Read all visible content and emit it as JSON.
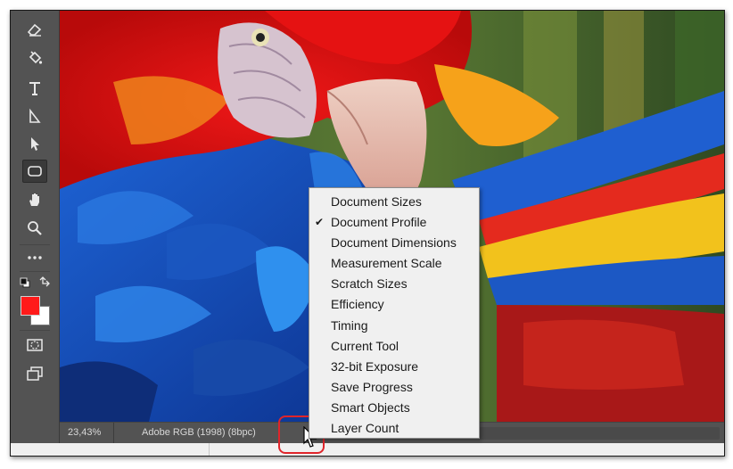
{
  "status_bar": {
    "zoom": "23,43%",
    "doc_info": "Adobe RGB (1998) (8bpc)",
    "arrow_icon": "chevron-right-icon"
  },
  "toolbar": {
    "tools": [
      {
        "name": "eraser-tool",
        "icon": "eraser-icon"
      },
      {
        "name": "fill-tool",
        "icon": "paint-bucket-icon"
      },
      {
        "name": "type-tool",
        "icon": "type-icon"
      },
      {
        "name": "path-selection-tool",
        "icon": "path-selection-icon"
      },
      {
        "name": "direct-selection-tool",
        "icon": "direct-selection-icon"
      },
      {
        "name": "rectangle-tool",
        "icon": "rounded-rectangle-icon",
        "active": true
      },
      {
        "name": "hand-tool",
        "icon": "hand-icon"
      },
      {
        "name": "zoom-tool",
        "icon": "magnifier-icon"
      },
      {
        "name": "more-tools",
        "icon": "ellipsis-icon"
      },
      {
        "name": "quick-mask-tool",
        "icon": "quick-mask-icon"
      },
      {
        "name": "screen-mode-tool",
        "icon": "screen-mode-icon"
      }
    ],
    "foreground_color": "#ff1a1a",
    "background_color": "#ffffff"
  },
  "menu": {
    "items": [
      {
        "label": "Document Sizes",
        "checked": false
      },
      {
        "label": "Document Profile",
        "checked": true
      },
      {
        "label": "Document Dimensions",
        "checked": false
      },
      {
        "label": "Measurement Scale",
        "checked": false
      },
      {
        "label": "Scratch Sizes",
        "checked": false
      },
      {
        "label": "Efficiency",
        "checked": false
      },
      {
        "label": "Timing",
        "checked": false
      },
      {
        "label": "Current Tool",
        "checked": false
      },
      {
        "label": "32-bit Exposure",
        "checked": false
      },
      {
        "label": "Save Progress",
        "checked": false
      },
      {
        "label": "Smart Objects",
        "checked": false
      },
      {
        "label": "Layer Count",
        "checked": false
      }
    ],
    "check_glyph": "✔"
  },
  "colors": {
    "toolbar_bg": "#535353",
    "menu_bg": "#f0f0f0",
    "highlight": "#e0242a"
  }
}
